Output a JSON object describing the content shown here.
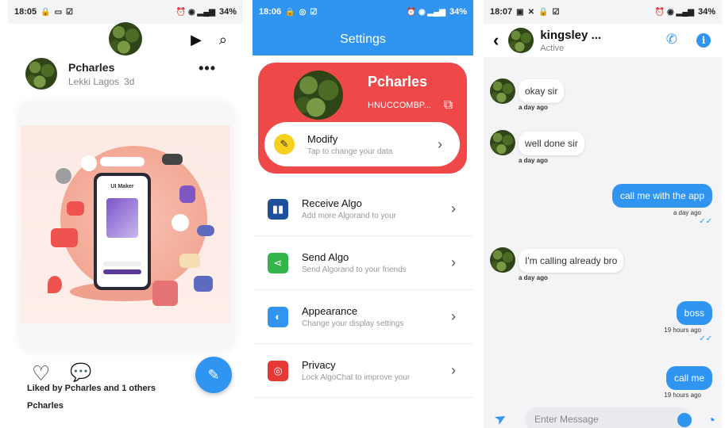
{
  "feed": {
    "status_time": "18:05",
    "battery": "34%",
    "post": {
      "author": "Pcharles",
      "location": "Lekki Lagos",
      "age": "3d",
      "image_title": "UI Maker",
      "likes_text": "Liked by Pcharles and 1 others",
      "caption_author": "Pcharles"
    }
  },
  "settings": {
    "status_time": "18:06",
    "battery": "34%",
    "header_title": "Settings",
    "profile": {
      "name": "Pcharles",
      "id": "HNUCCOMBP...",
      "modify_title": "Modify",
      "modify_sub": "Tap to change your data"
    },
    "rows": [
      {
        "title": "Receive Algo",
        "sub": "Add more Algorand to your",
        "icon": "barcode-icon",
        "color": "#1e4f9c"
      },
      {
        "title": "Send Algo",
        "sub": "Send Algorand to your friends",
        "icon": "share-icon",
        "color": "#33b54a"
      },
      {
        "title": "Appearance",
        "sub": "Change your display settings",
        "icon": "palette-icon",
        "color": "#2f95f0"
      },
      {
        "title": "Privacy",
        "sub": "Lock AlgoChat to improve your",
        "icon": "fingerprint-icon",
        "color": "#e53935"
      }
    ]
  },
  "chat": {
    "status_time": "18:07",
    "battery": "34%",
    "contact": "kingsley ...",
    "status": "Active",
    "messages": [
      {
        "dir": "in",
        "text": "okay sir",
        "time": "a day ago"
      },
      {
        "dir": "in",
        "text": "well done sir",
        "time": "a day ago"
      },
      {
        "dir": "out",
        "text": "call me with the app",
        "time": "a day ago"
      },
      {
        "dir": "in",
        "text": "I'm calling already bro",
        "time": "a day ago"
      },
      {
        "dir": "out",
        "text": "boss",
        "time": "19 hours ago"
      },
      {
        "dir": "out",
        "text": "call me",
        "time": "19 hours ago"
      }
    ],
    "input_placeholder": "Enter Message"
  },
  "colors": {
    "accent": "#2f95f0",
    "profile_card": "#ef4848"
  }
}
